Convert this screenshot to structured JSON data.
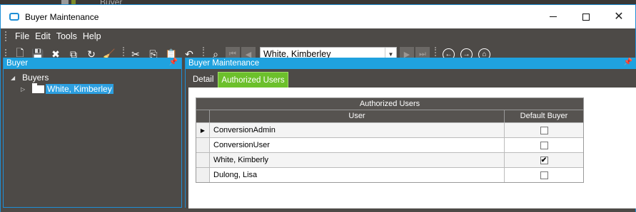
{
  "background": {
    "partial_title": "Buyer"
  },
  "window": {
    "title": "Buyer Maintenance",
    "controls": {
      "minimize": "minimize",
      "maximize": "maximize",
      "close": "✕"
    }
  },
  "menu": [
    "File",
    "Edit",
    "Tools",
    "Help"
  ],
  "toolbar": {
    "combo_value": "White, Kimberley"
  },
  "left_pane": {
    "header": "Buyer",
    "tree": {
      "root": "Buyers",
      "child": "White, Kimberley"
    }
  },
  "right_pane": {
    "header": "Buyer Maintenance",
    "tabs": [
      "Detail",
      "Authorized Users"
    ],
    "active_tab": "Authorized Users",
    "grid": {
      "band_title": "Authorized Users",
      "columns": [
        "User",
        "Default Buyer"
      ],
      "rows": [
        {
          "user": "ConversionAdmin",
          "default": false,
          "current": true
        },
        {
          "user": "ConversionUser",
          "default": false,
          "current": false
        },
        {
          "user": "White, Kimberly",
          "default": true,
          "current": false
        },
        {
          "user": "Dulong, Lisa",
          "default": false,
          "current": false
        }
      ]
    }
  },
  "colors": {
    "accent_blue": "#1fa2df",
    "tab_active_green": "#6cc02b",
    "chrome_dark": "#4d4a47"
  }
}
